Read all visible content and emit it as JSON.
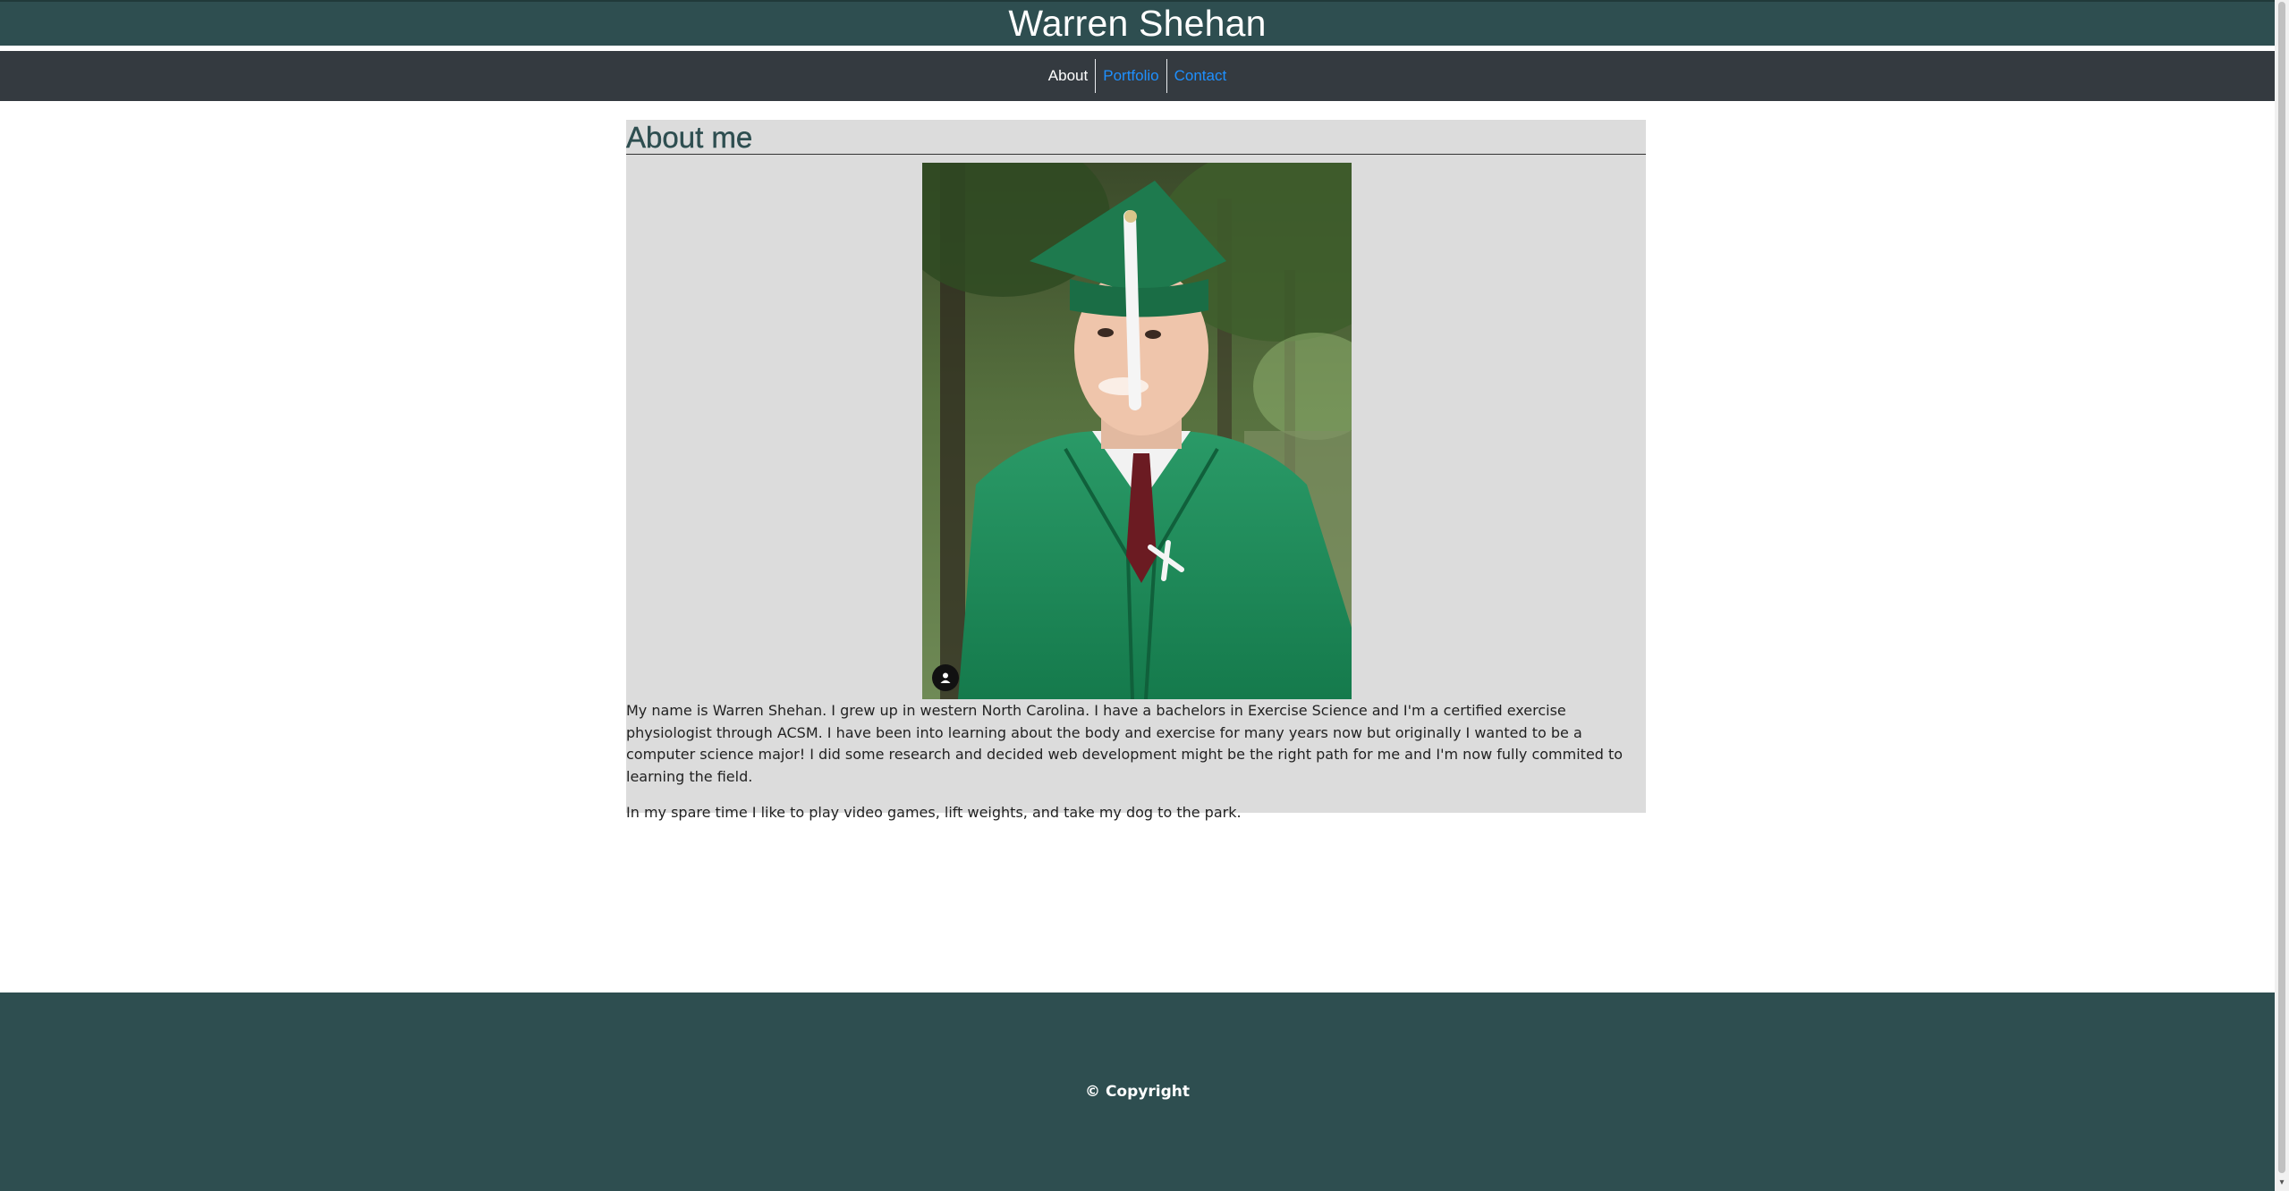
{
  "header": {
    "title": "Warren Shehan"
  },
  "nav": {
    "items": [
      {
        "label": "About"
      },
      {
        "label": "Portfolio"
      },
      {
        "label": "Contact"
      }
    ]
  },
  "about": {
    "heading": "About me",
    "paragraphs": [
      "My name is Warren Shehan. I grew up in western North Carolina. I have a bachelors in Exercise Science and I'm a certified exercise physiologist through ACSM. I have been into learning about the body and exercise for many years now but originally I wanted to be a computer science major! I did some research and decided web development might be the right path for me and I'm now fully commited to learning the field.",
      "In my spare time I like to play video games, lift weights, and take my dog to the park."
    ]
  },
  "footer": {
    "text": "© Copyright"
  },
  "colors": {
    "header": "#2e4e50",
    "nav": "#343a40",
    "link": "#1e90ff",
    "section_bg": "#dcdcdc"
  },
  "icons": {
    "photo_badge": "person-icon",
    "scroll": "chevron-down-icon"
  }
}
